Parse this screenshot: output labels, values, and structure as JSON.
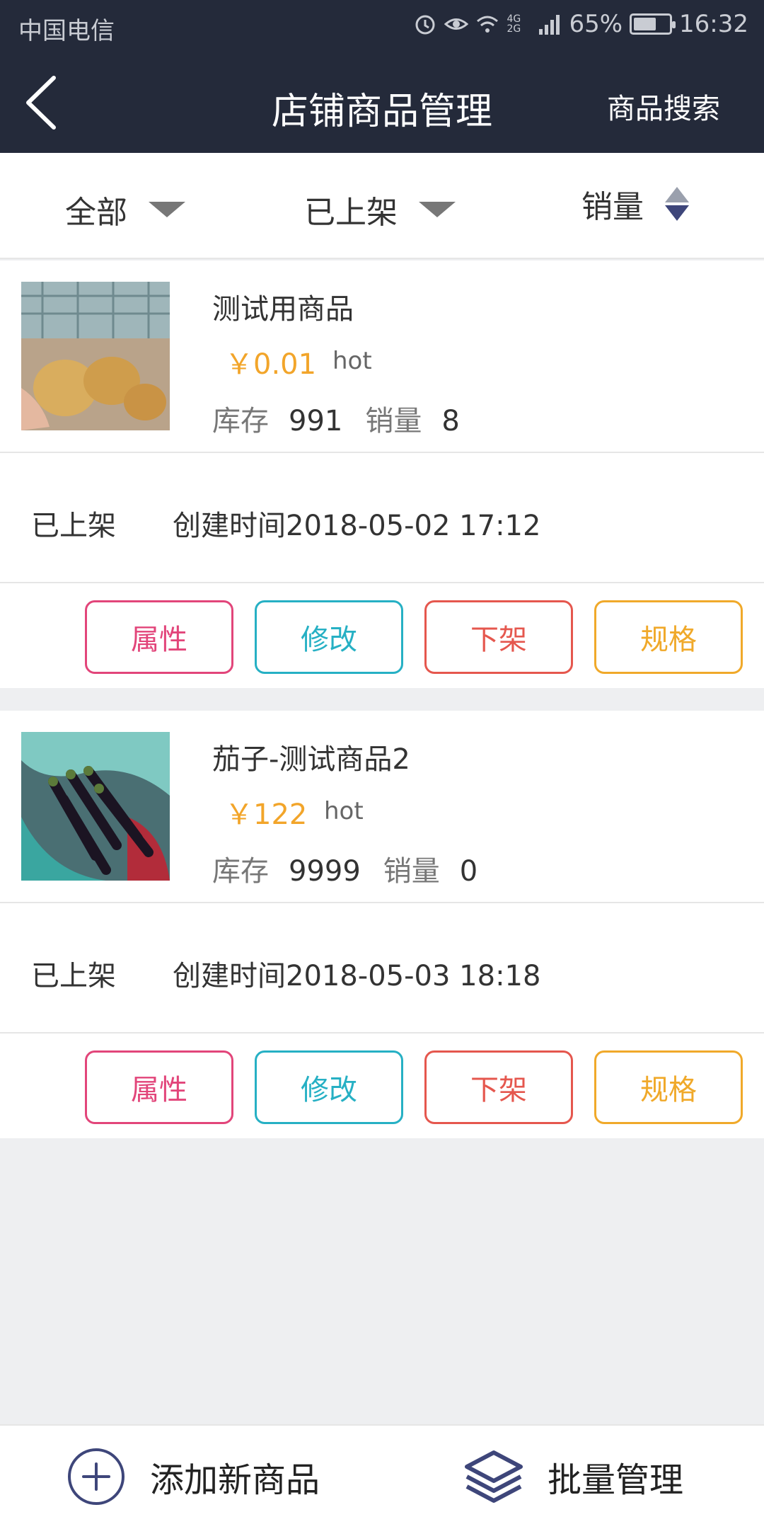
{
  "status_bar": {
    "carrier": "中国电信",
    "battery": "65%",
    "time": "16:32",
    "network": "4G 2G",
    "battery_level": 0.65
  },
  "header": {
    "title": "店铺商品管理",
    "search_label": "商品搜索"
  },
  "filters": {
    "category": "全部",
    "status": "已上架",
    "sort": "销量"
  },
  "labels": {
    "stock": "库存",
    "sales": "销量"
  },
  "products": [
    {
      "name": "测试用商品",
      "price": "￥0.01",
      "tag": "hot",
      "stock": "991",
      "sales": "8",
      "status": "已上架",
      "created": "创建时间2018-05-02 17:12",
      "buttons": [
        "属性",
        "修改",
        "下架",
        "规格"
      ]
    },
    {
      "name": "茄子-测试商品2",
      "price": "￥122",
      "tag": "hot",
      "stock": "9999",
      "sales": "0",
      "status": "已上架",
      "created": "创建时间2018-05-03 18:18",
      "buttons": [
        "属性",
        "修改",
        "下架",
        "规格"
      ]
    }
  ],
  "bottom": {
    "add_label": "添加新商品",
    "batch_label": "批量管理"
  },
  "colors": {
    "header_bg": "#242a3a",
    "price": "#f2a52a",
    "btn_attr": "#e2457a",
    "btn_edit": "#26b0c4",
    "btn_off": "#e5574e",
    "btn_spec": "#f0a92a",
    "icon": "#3e467a"
  }
}
